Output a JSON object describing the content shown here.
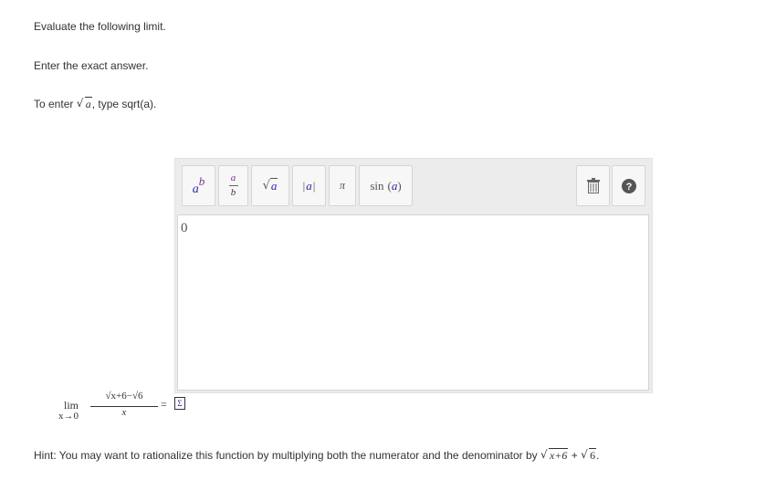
{
  "instructions": {
    "line1": "Evaluate the following limit.",
    "line2": "Enter the exact answer.",
    "line3_prefix": "To enter ",
    "line3_math": "a",
    "line3_suffix": ", type sqrt(a)."
  },
  "editor": {
    "toolbar": {
      "power_base": "a",
      "power_exp": "b",
      "frac_num": "a",
      "frac_den": "b",
      "sqrt_arg": "a",
      "abs_open": "|",
      "abs_arg": "a",
      "abs_close": "|",
      "pi": "π",
      "sin_func": "sin",
      "sin_open": "(",
      "sin_arg": "a",
      "sin_close": ")"
    },
    "value": "0"
  },
  "problem": {
    "lim": "lim",
    "lim_sub": "x→0",
    "numerator": "√x+6−√6",
    "denominator": "x",
    "equals": "="
  },
  "hint": {
    "prefix": "Hint: You may want to rationalize this function by multiplying both the numerator and the denominator by ",
    "math_a": "x+6",
    "plus": " + ",
    "math_b": "6",
    "suffix": "."
  },
  "colors": {
    "toolbar_bg": "#ececec",
    "math_blue": "#2a2aa5",
    "math_purple": "#7a2f91"
  }
}
